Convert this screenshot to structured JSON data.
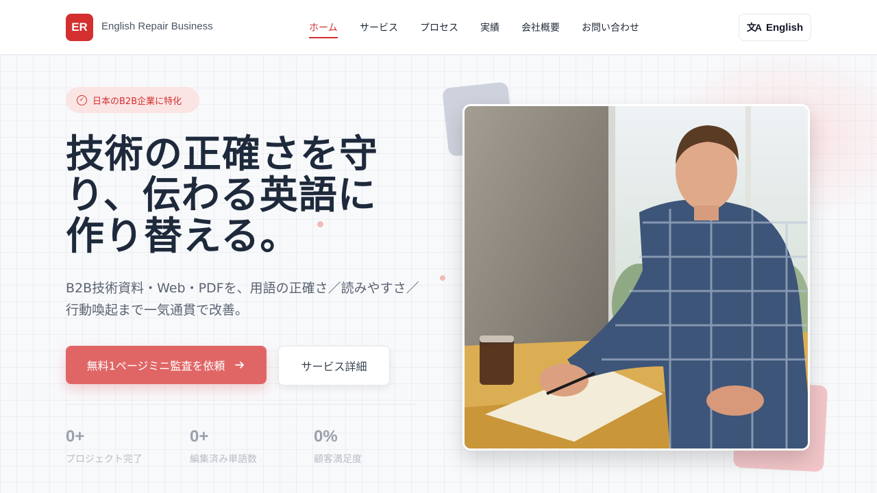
{
  "header": {
    "logo_text": "ER",
    "brand": "English Repair Business",
    "nav": [
      {
        "label": "ホーム",
        "active": true
      },
      {
        "label": "サービス",
        "active": false
      },
      {
        "label": "プロセス",
        "active": false
      },
      {
        "label": "実績",
        "active": false
      },
      {
        "label": "会社概要",
        "active": false
      },
      {
        "label": "お問い合わせ",
        "active": false
      }
    ],
    "language_button": "English"
  },
  "hero": {
    "badge": "日本のB2B企業に特化",
    "headline_lines": [
      "技術の正確さを守",
      "り、伝わる英語に",
      "作り替える。"
    ],
    "subtitle": "B2B技術資料・Web・PDFを、用語の正確さ／読みやすさ／行動喚起まで一気通貫で改善。",
    "cta_primary": "無料1ページミニ監査を依頼",
    "cta_secondary": "サービス詳細",
    "stats": [
      {
        "value": "0+",
        "label": "プロジェクト完了"
      },
      {
        "value": "0+",
        "label": "編集済み単語数"
      },
      {
        "value": "0%",
        "label": "顧客満足度"
      }
    ]
  },
  "colors": {
    "brand": "#d32f2f",
    "cta": "#e06666",
    "badge_bg": "#fbe4e4"
  }
}
